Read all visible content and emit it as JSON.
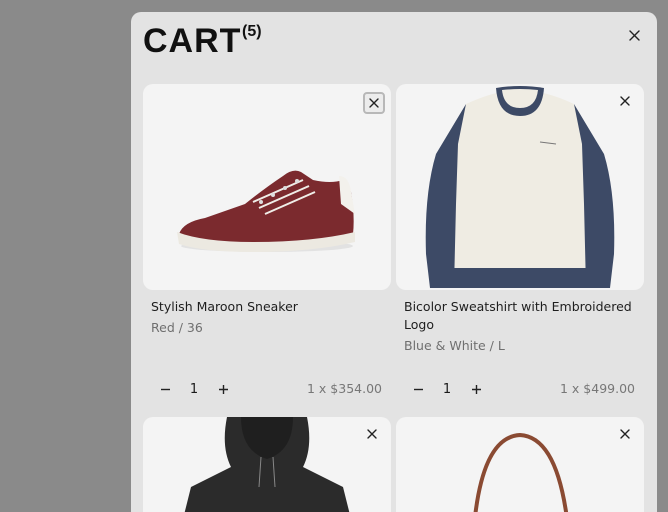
{
  "cart": {
    "title": "CART",
    "count": "(5)",
    "close_icon": "close-icon"
  },
  "items": [
    {
      "name": "Stylish Maroon Sneaker",
      "variant": "Red / 36",
      "quantity": "1",
      "price": "1 x $354.00",
      "colors": {
        "main": "#7b2a2e",
        "sole": "#ece9e1"
      }
    },
    {
      "name": "Bicolor Sweatshirt with Embroidered Logo",
      "variant": "Blue & White / L",
      "quantity": "1",
      "price": "1 x $499.00",
      "colors": {
        "body": "#efece3",
        "sleeves": "#3d4a66"
      }
    },
    {
      "name": "",
      "variant": "",
      "quantity": "",
      "price": "",
      "colors": {
        "main": "#2b2b2b"
      }
    },
    {
      "name": "",
      "variant": "",
      "quantity": "",
      "price": "",
      "colors": {
        "strap": "#8a4a32"
      }
    }
  ],
  "icons": {
    "remove": "close-icon",
    "decrease": "minus-icon",
    "increase": "plus-icon"
  }
}
